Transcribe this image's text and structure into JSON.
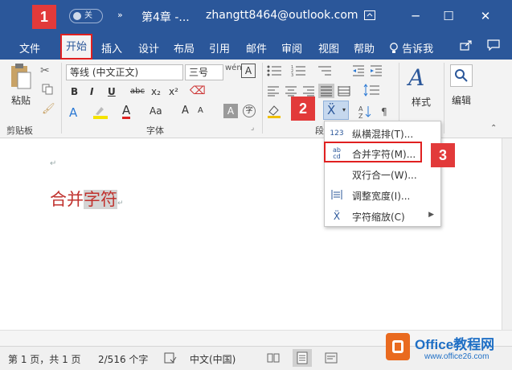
{
  "titlebar": {
    "toggle_label": "关",
    "more": "»",
    "doc_title": "第4章 -...",
    "user": "zhangtt8464@outlook.com",
    "ribbon_display_icon": "ribbon-display-icon",
    "minimize": "─",
    "maximize": "☐",
    "close": "✕"
  },
  "tabs": {
    "items": [
      "文件",
      "开始",
      "插入",
      "设计",
      "布局",
      "引用",
      "邮件",
      "审阅",
      "视图",
      "帮助"
    ],
    "tell_me": "告诉我",
    "share_icon": "share-icon",
    "comment_icon": "comment-icon"
  },
  "ribbon": {
    "clipboard": {
      "paste_label": "粘贴",
      "group_label": "剪贴板"
    },
    "font": {
      "font_name": "等线 (中文正文)",
      "font_size": "三号",
      "group_label": "字体",
      "bold": "B",
      "italic": "I",
      "underline": "U",
      "strike": "abc",
      "subscript": "x₂",
      "superscript": "x²",
      "grow": "A",
      "shrink": "A",
      "case": "Aa"
    },
    "paragraph": {
      "group_label": "段"
    },
    "styles": {
      "label": "样式"
    },
    "editing": {
      "label": "编辑"
    }
  },
  "badges": {
    "b1": "1",
    "b2": "2",
    "b3": "3"
  },
  "menu": {
    "items": [
      {
        "label": "纵横混排(T)...",
        "icon": "vertical-horizontal-icon"
      },
      {
        "label": "合并字符(M)...",
        "icon": "combine-characters-icon"
      },
      {
        "label": "双行合一(W)...",
        "icon": ""
      },
      {
        "label": "调整宽度(I)...",
        "icon": "adjust-width-icon"
      },
      {
        "label": "字符缩放(C)",
        "icon": "character-scale-icon"
      }
    ]
  },
  "document": {
    "text_before": "合并",
    "text_selected": "字符",
    "para_mark": "↵"
  },
  "status": {
    "page": "第 1 页，共 1 页",
    "words": "2/516 个字",
    "language": "中文(中国)"
  },
  "watermark": {
    "brand": "Office教程网",
    "url": "www.office26.com"
  },
  "colors": {
    "accent": "#2b579a",
    "highlight_red": "#e02020",
    "text_red": "#c0322e"
  }
}
